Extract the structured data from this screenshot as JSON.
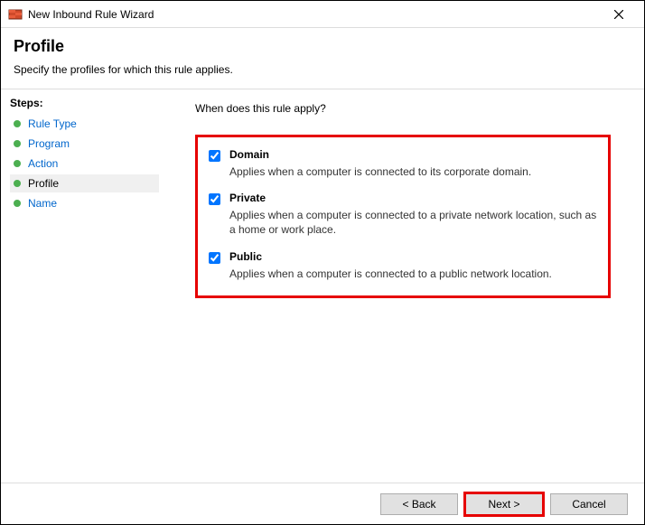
{
  "window": {
    "title": "New Inbound Rule Wizard"
  },
  "header": {
    "title": "Profile",
    "subtitle": "Specify the profiles for which this rule applies."
  },
  "sidebar": {
    "heading": "Steps:",
    "items": [
      {
        "label": "Rule Type"
      },
      {
        "label": "Program"
      },
      {
        "label": "Action"
      },
      {
        "label": "Profile"
      },
      {
        "label": "Name"
      }
    ]
  },
  "content": {
    "question": "When does this rule apply?",
    "options": [
      {
        "label": "Domain",
        "desc": "Applies when a computer is connected to its corporate domain."
      },
      {
        "label": "Private",
        "desc": "Applies when a computer is connected to a private network location, such as a home or work place."
      },
      {
        "label": "Public",
        "desc": "Applies when a computer is connected to a public network location."
      }
    ]
  },
  "footer": {
    "back": "< Back",
    "next": "Next >",
    "cancel": "Cancel"
  }
}
